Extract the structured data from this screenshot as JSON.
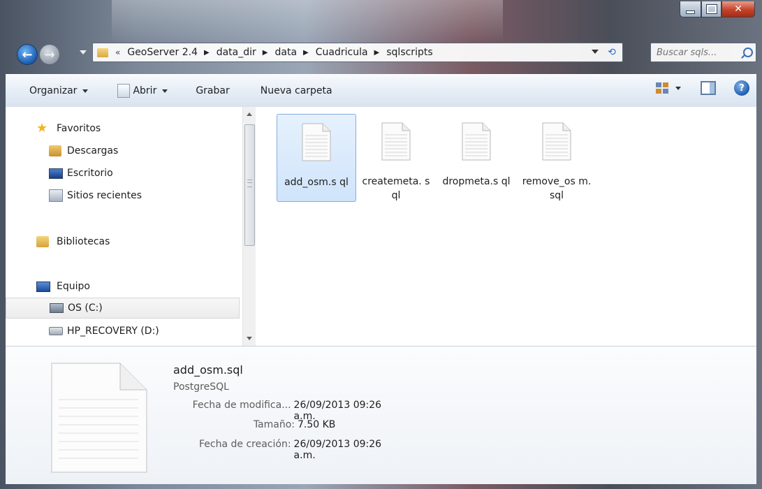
{
  "window": {
    "caption_buttons": {
      "minimize": "minimize-icon",
      "maximize": "maximize-icon",
      "close": "close-icon"
    }
  },
  "address_bar": {
    "overflow": "«",
    "breadcrumbs": [
      "GeoServer 2.4",
      "data_dir",
      "data",
      "Cuadricula",
      "sqlscripts"
    ]
  },
  "search": {
    "placeholder": "Buscar sqls..."
  },
  "toolbar": {
    "organize_label": "Organizar",
    "open_label": "Abrir",
    "burn_label": "Grabar",
    "new_folder_label": "Nueva carpeta"
  },
  "nav": {
    "favorites_label": "Favoritos",
    "downloads_label": "Descargas",
    "desktop_label": "Escritorio",
    "recent_label": "Sitios recientes",
    "libraries_label": "Bibliotecas",
    "computer_label": "Equipo",
    "drive_c_label": "OS (C:)",
    "drive_d_label": "HP_RECOVERY (D:)"
  },
  "files": [
    {
      "name": "add_osm.sql",
      "display": "add_osm.s ql",
      "selected": true
    },
    {
      "name": "createmeta.sql",
      "display": "createmeta. sql",
      "selected": false
    },
    {
      "name": "dropmeta.sql",
      "display": "dropmeta.s ql",
      "selected": false
    },
    {
      "name": "remove_osm.sql",
      "display": "remove_os m.sql",
      "selected": false
    }
  ],
  "details": {
    "name": "add_osm.sql",
    "type": "PostgreSQL",
    "modified_label": "Fecha de modifica...",
    "modified_value": "26/09/2013 09:26 a.m.",
    "size_label": "Tamaño:",
    "size_value": "7.50 KB",
    "created_label": "Fecha de creación:",
    "created_value": "26/09/2013 09:26 a.m."
  }
}
